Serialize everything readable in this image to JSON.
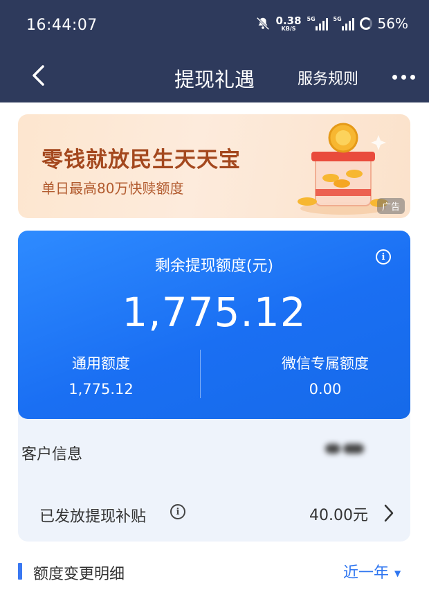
{
  "status_bar": {
    "time": "16:44:07",
    "net_speed_value": "0.38",
    "net_speed_unit": "KB/S",
    "sim1_tag": "5G",
    "sim2_tag": "5G",
    "battery": "56%"
  },
  "nav": {
    "title": "提现礼遇",
    "rules_link": "服务规则"
  },
  "banner": {
    "title": "零钱就放民生天天宝",
    "subtitle": "单日最高80万快赎额度",
    "ad_label": "广告"
  },
  "quota_card": {
    "remaining_label": "剩余提现额度(元)",
    "remaining_amount": "1,775.12",
    "general_label": "通用额度",
    "general_value": "1,775.12",
    "wechat_label": "微信专属额度",
    "wechat_value": "0.00"
  },
  "info": {
    "customer_label": "客户信息",
    "subsidy_label": "已发放提现补贴",
    "subsidy_value": "40.00元"
  },
  "section": {
    "title": "额度变更明细",
    "filter_value": "近一年"
  },
  "colors": {
    "header_bg": "#2e3a5c",
    "card_blue": "#1a6ff3",
    "accent_link": "#2f76f0",
    "banner_text": "#a4481e"
  }
}
